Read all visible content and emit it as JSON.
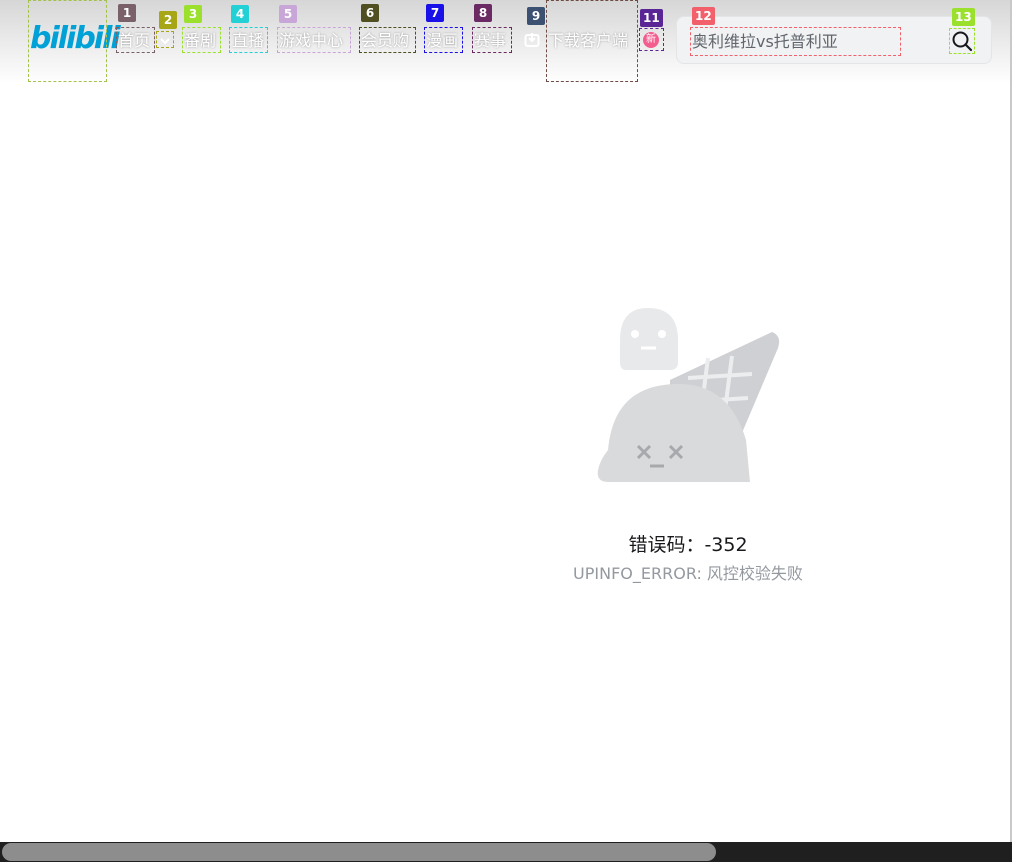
{
  "header": {
    "logo": "bilibili",
    "nav": [
      {
        "label": "首页"
      },
      {
        "label": "番剧"
      },
      {
        "label": "直播"
      },
      {
        "label": "游戏中心"
      },
      {
        "label": "会员购"
      },
      {
        "label": "漫画"
      },
      {
        "label": "赛事"
      },
      {
        "label": "下载客户端"
      }
    ],
    "badge_new": "新",
    "search": {
      "placeholder": "奥利维拉vs托普利亚"
    }
  },
  "markers": [
    "1",
    "2",
    "3",
    "4",
    "5",
    "6",
    "7",
    "8",
    "9",
    "11",
    "12",
    "13"
  ],
  "error": {
    "code_label": "错误码：-352",
    "message": "UPINFO_ERROR: 风控校验失败"
  },
  "colors": {
    "brand": "#00a1d6",
    "badge": "#f25d8e",
    "illustration": "#d9dadc"
  }
}
